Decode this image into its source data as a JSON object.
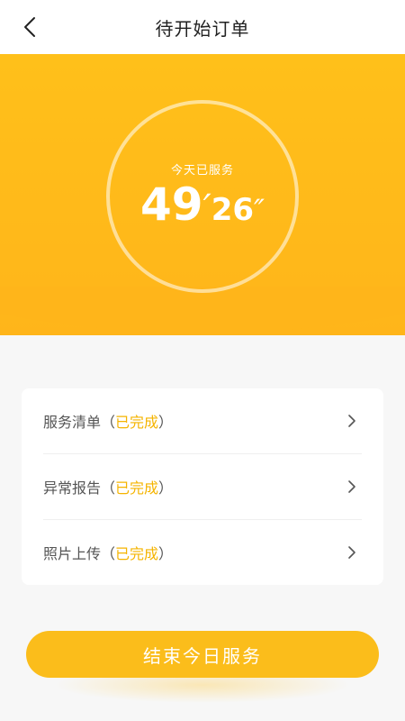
{
  "header": {
    "title": "待开始订单",
    "back_icon": "chevron-left-icon"
  },
  "hero": {
    "caption": "今天已服务",
    "minutes": "49",
    "minute_mark": "′",
    "seconds": "26",
    "second_mark": "″",
    "color": "#ffb81a"
  },
  "tasks": {
    "items": [
      {
        "label": "服务清单",
        "open_paren": "（",
        "status": "已完成",
        "close_paren": "）"
      },
      {
        "label": "异常报告",
        "open_paren": "（",
        "status": "已完成",
        "close_paren": "）"
      },
      {
        "label": "照片上传",
        "open_paren": "（",
        "status": "已完成",
        "close_paren": "）"
      }
    ],
    "status_color": "#f5b400",
    "arrow_icon": "chevron-right-icon"
  },
  "footer": {
    "end_button_label": "结束今日服务"
  }
}
